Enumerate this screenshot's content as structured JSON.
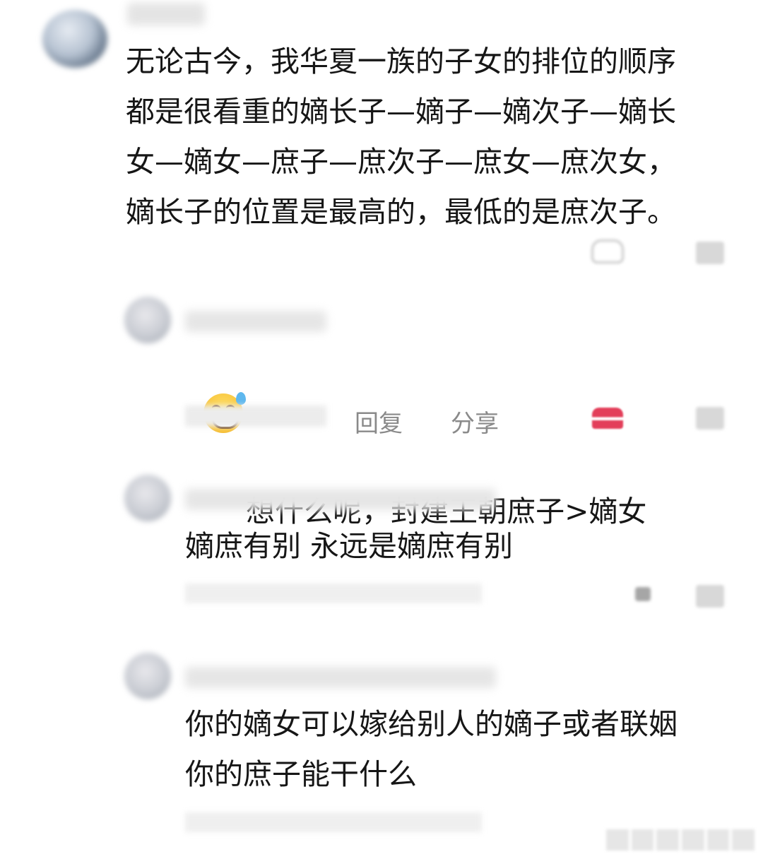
{
  "comments": [
    {
      "text": "无论古今，我华夏一族的子女的排位的顺序\n都是很看重的嫡长子—嫡子—嫡次子—嫡长\n女—嫡女—庶子—庶次子—庶女—庶次女，\n嫡长子的位置是最高的，最低的是庶次子。"
    },
    {
      "text": "想什么呢，封建王朝庶子>嫡女",
      "reply_label": "回复",
      "share_label": "分享"
    },
    {
      "text": "嫡庶有别 永远是嫡庶有别"
    },
    {
      "text": "你的嫡女可以嫁给别人的嫡子或者联姻\n你的庶子能干什么"
    }
  ],
  "icons": {
    "emoji": "grinning-sweat-emoji",
    "like": "heart-icon",
    "dislike": "thumbs-down-icon"
  },
  "colors": {
    "like_red": "#e33f5a",
    "meta_gray": "#8a8a8a"
  }
}
